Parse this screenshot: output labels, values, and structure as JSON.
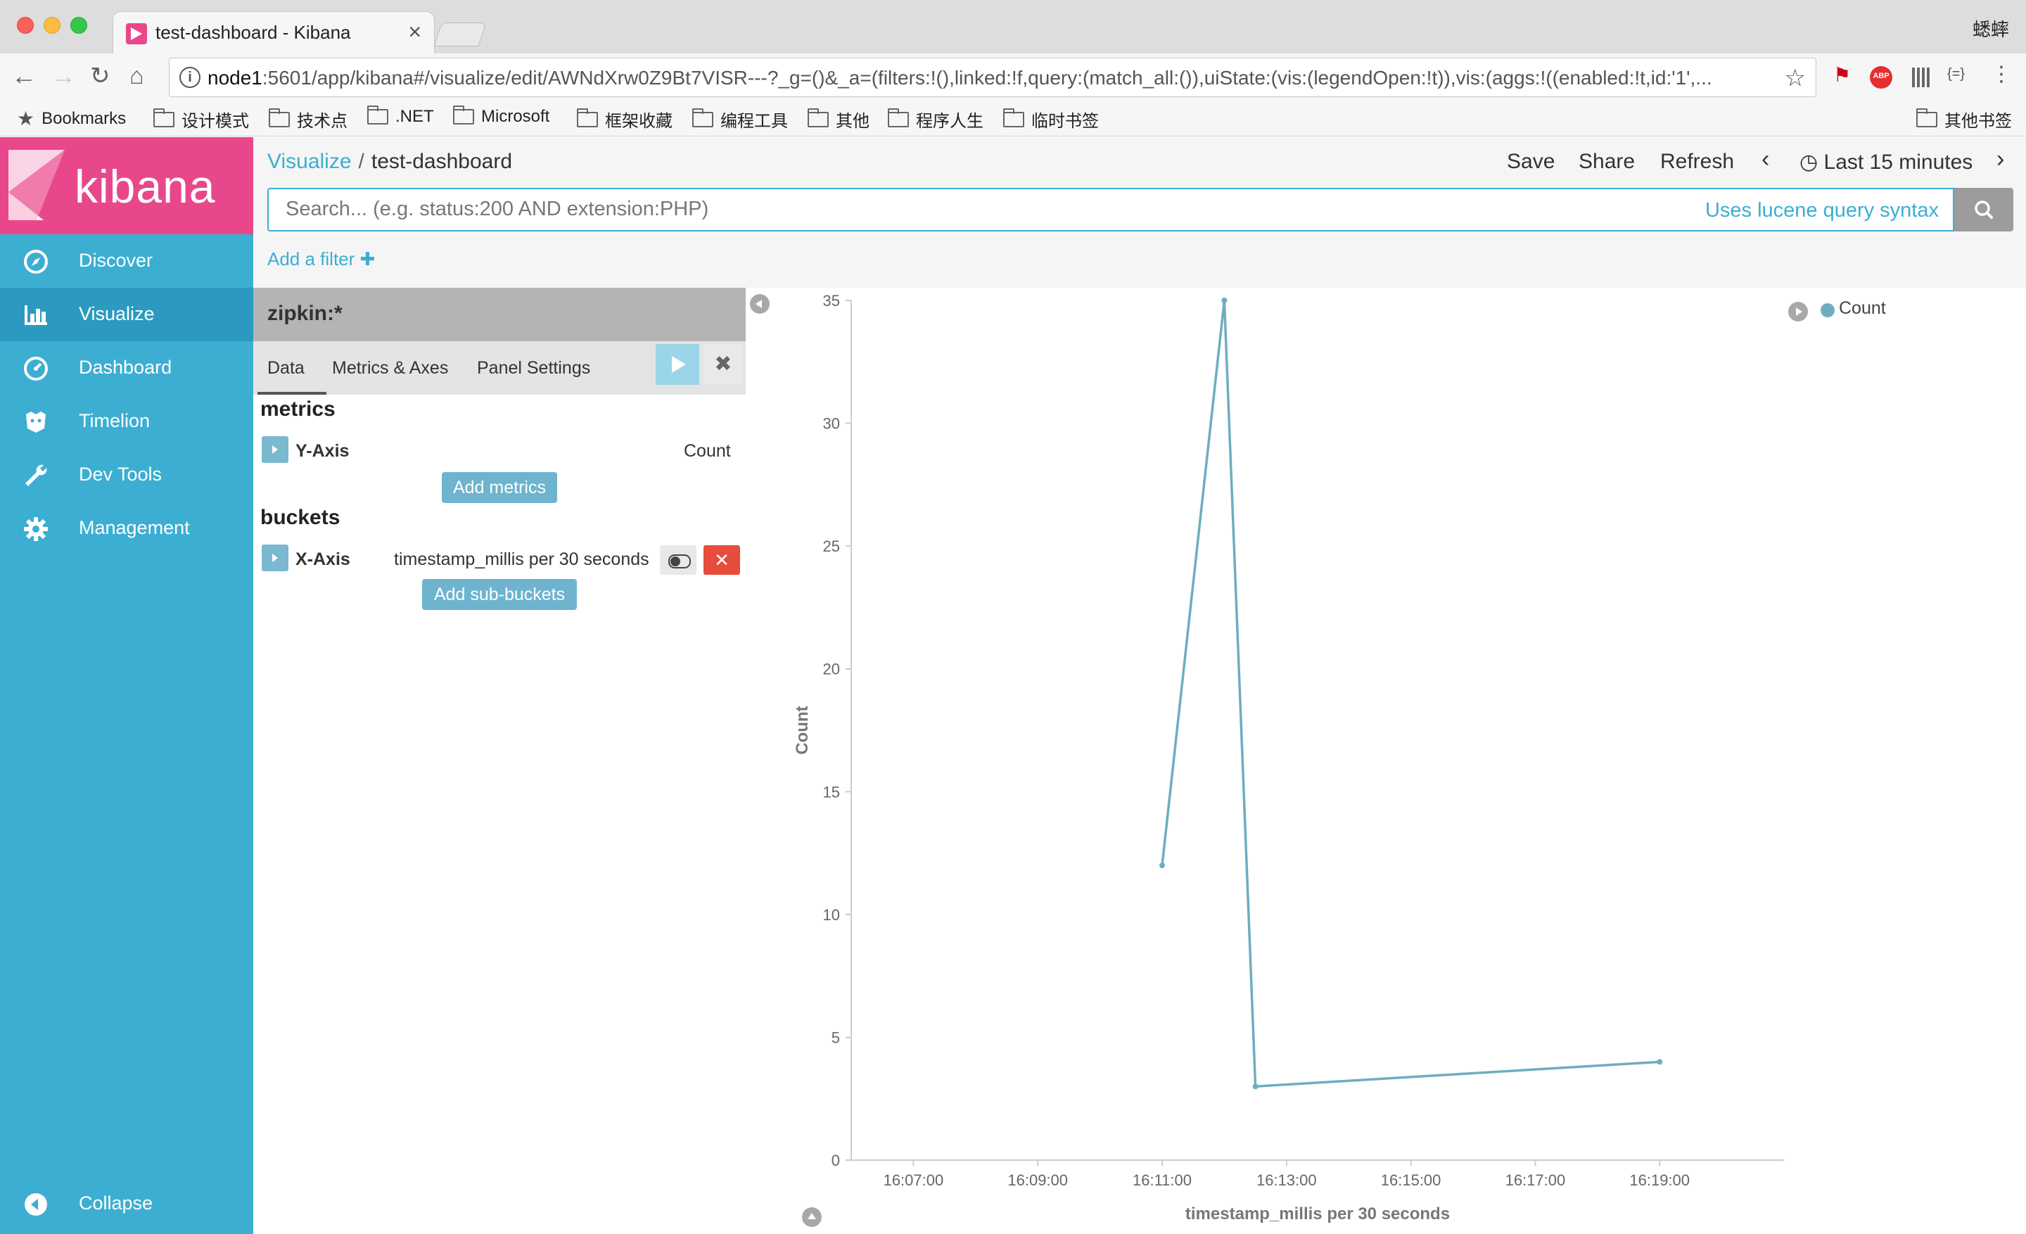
{
  "browser": {
    "tab_title": "test-dashboard - Kibana",
    "tab_close": "×",
    "user_name": "蟋蟀",
    "url_host": "node1",
    "url_rest": ":5601/app/kibana#/visualize/edit/AWNdXrw0Z9Bt7VISR---?_g=()&_a=(filters:!(),linked:!f,query:(match_all:()),uiState:(vis:(legendOpen:!t)),vis:(aggs:!((enabled:!t,id:'1',...",
    "ext_abp": "ABP",
    "ext_json": "{=}",
    "bookmarks": [
      "Bookmarks",
      "设计模式",
      "技术点",
      ".NET",
      "Microsoft",
      "框架收藏",
      "编程工具",
      "其他",
      "程序人生",
      "临时书签"
    ],
    "other_bookmarks": "其他书签"
  },
  "sidebar": {
    "logo": "kibana",
    "items": [
      {
        "label": "Discover",
        "icon": "compass-icon"
      },
      {
        "label": "Visualize",
        "icon": "bar-chart-icon"
      },
      {
        "label": "Dashboard",
        "icon": "dashboard-icon"
      },
      {
        "label": "Timelion",
        "icon": "timelion-icon"
      },
      {
        "label": "Dev Tools",
        "icon": "wrench-icon"
      },
      {
        "label": "Management",
        "icon": "gear-icon"
      }
    ],
    "collapse": "Collapse",
    "colors": {
      "bg": "#3caed2",
      "active": "#2c9ac0",
      "logo_bg": "#e8488b"
    }
  },
  "topbar": {
    "breadcrumb_link": "Visualize",
    "breadcrumb_sep": "/",
    "breadcrumb_current": "test-dashboard",
    "save": "Save",
    "share": "Share",
    "refresh": "Refresh",
    "time_range": "Last 15 minutes",
    "search_placeholder": "Search... (e.g. status:200 AND extension:PHP)",
    "lucene_link": "Uses lucene query syntax",
    "add_filter": "Add a filter"
  },
  "editor": {
    "index_pattern": "zipkin:*",
    "tabs": [
      "Data",
      "Metrics & Axes",
      "Panel Settings"
    ],
    "metrics_title": "metrics",
    "metric": {
      "name": "Y-Axis",
      "desc": "Count"
    },
    "add_metrics": "Add metrics",
    "buckets_title": "buckets",
    "bucket": {
      "name": "X-Axis",
      "desc": "timestamp_millis per 30 seconds"
    },
    "add_sub_buckets": "Add sub-buckets"
  },
  "chart_data": {
    "type": "line",
    "x_ticks": [
      "16:07:00",
      "16:09:00",
      "16:11:00",
      "16:13:00",
      "16:15:00",
      "16:17:00",
      "16:19:00"
    ],
    "x": [
      "16:11:00",
      "16:12:00",
      "16:12:30",
      "16:19:00"
    ],
    "series": [
      {
        "name": "Count",
        "color": "#6eadc1",
        "values": [
          12,
          35,
          3,
          4
        ]
      }
    ],
    "y_ticks": [
      0,
      5,
      10,
      15,
      20,
      25,
      30,
      35
    ],
    "ylim": [
      0,
      35
    ],
    "xlim": [
      "16:06:00",
      "16:21:00"
    ],
    "xlabel": "timestamp_millis per 30 seconds",
    "ylabel": "Count",
    "legend": "top-right",
    "grid": false
  }
}
